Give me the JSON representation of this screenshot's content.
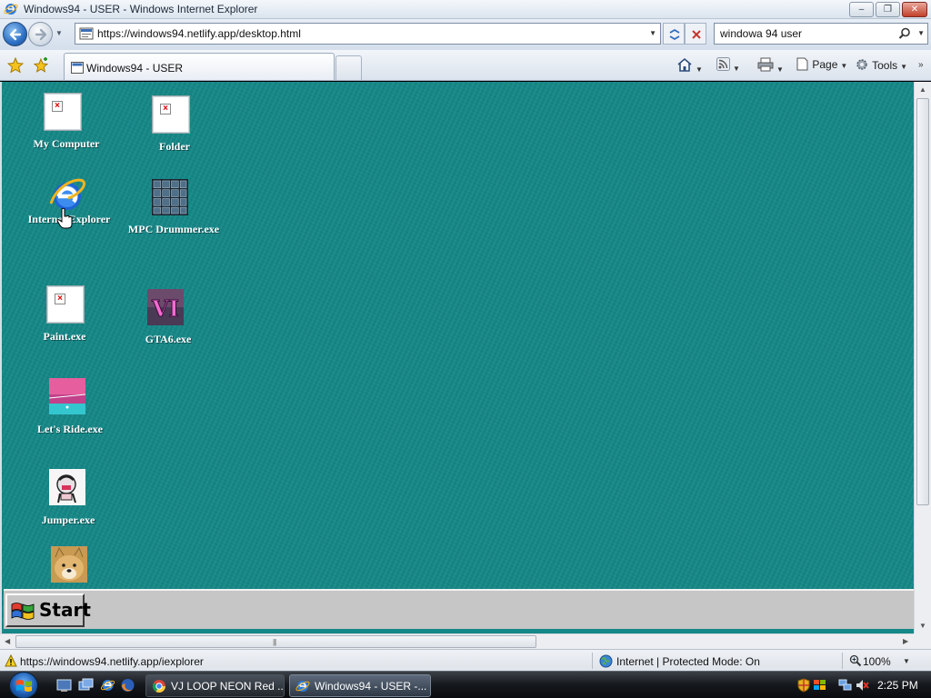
{
  "window": {
    "title": "Windows94 - USER - Windows Internet Explorer",
    "controls": {
      "minimize": "–",
      "maximize": "❐",
      "close": "✕"
    }
  },
  "address_bar": {
    "url": "https://windows94.netlify.app/desktop.html",
    "search_value": "windowa 94 user"
  },
  "tabs": [
    {
      "label": "Windows94 - USER",
      "active": true
    }
  ],
  "command_bar": {
    "page_label": "Page",
    "tools_label": "Tools"
  },
  "desktop": {
    "icons": [
      {
        "label": "My Computer",
        "icon": "broken-image-icon"
      },
      {
        "label": "Folder",
        "icon": "broken-image-icon"
      },
      {
        "label": "Internet Explorer",
        "icon": "internet-explorer-icon"
      },
      {
        "label": "MPC Drummer.exe",
        "icon": "drum-pad-grid-icon"
      },
      {
        "label": "Paint.exe",
        "icon": "broken-image-icon"
      },
      {
        "label": "GTA6.exe",
        "icon": "gta-vi-logo-icon"
      },
      {
        "label": "Let's Ride.exe",
        "icon": "pink-sunset-icon"
      },
      {
        "label": "Jumper.exe",
        "icon": "jumper-character-icon"
      },
      {
        "label": "",
        "icon": "doge-icon"
      }
    ],
    "background_color": "#148787",
    "start_button_label": "Start"
  },
  "status_bar": {
    "link_url": "https://windows94.netlify.app/iexplorer",
    "zone": "Internet | Protected Mode: On",
    "zoom": "100%"
  },
  "taskbar": {
    "items": [
      {
        "label": "VJ LOOP NEON Red ...",
        "icon": "chrome-icon"
      },
      {
        "label": "Windows94 - USER -...",
        "icon": "internet-explorer-icon",
        "active": true
      }
    ],
    "clock": "2:25 PM"
  }
}
